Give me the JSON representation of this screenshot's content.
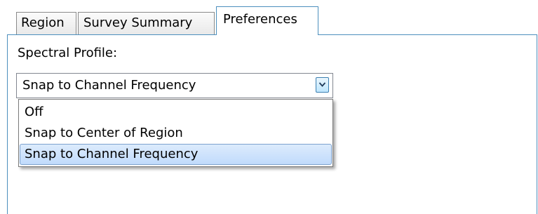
{
  "tabs": [
    {
      "label": "Region",
      "active": false
    },
    {
      "label": "Survey Summary",
      "active": false
    },
    {
      "label": "Preferences",
      "active": true
    }
  ],
  "preferences": {
    "spectral_profile_label": "Spectral Profile:",
    "spectral_profile_value": "Snap to Channel Frequency",
    "options": [
      "Off",
      "Snap to Center of Region",
      "Snap to Channel Frequency"
    ],
    "highlighted_option": "Snap to Channel Frequency",
    "dropdown_open": true
  },
  "colors": {
    "accent_border": "#4c8fbd",
    "highlight_fill": "#c1dbfc",
    "highlight_border": "#7da2ce"
  },
  "icons": {
    "combo_arrow": "chevron-down-icon"
  }
}
